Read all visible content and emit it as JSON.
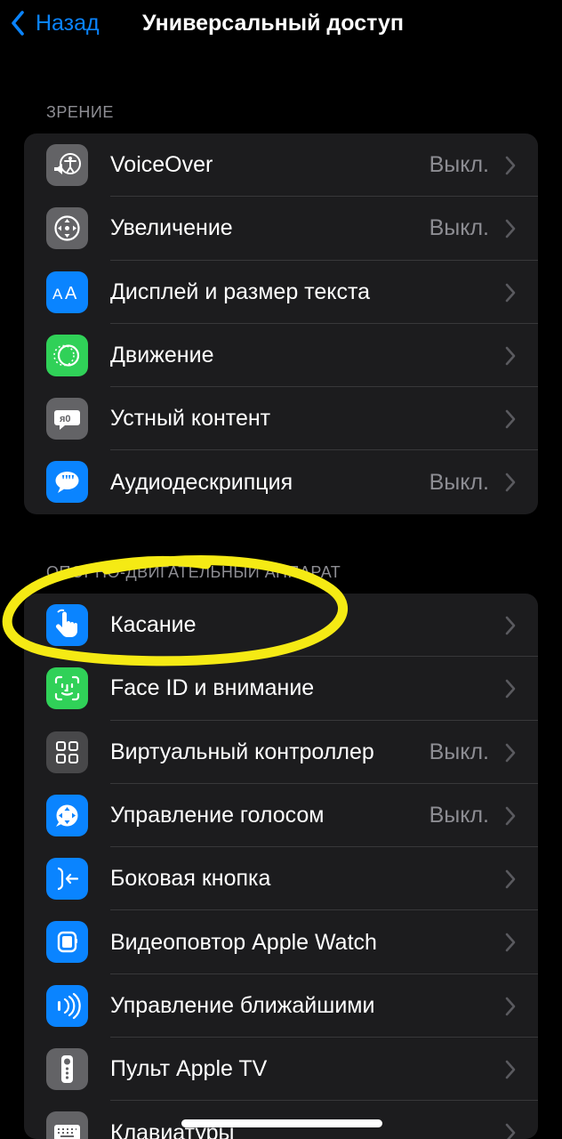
{
  "nav": {
    "back_label": "Назад",
    "title": "Универсальный доступ"
  },
  "vision": {
    "header": "ЗРЕНИЕ",
    "items": [
      {
        "label": "VoiceOver",
        "value": "Выкл.",
        "icon": "voiceover-icon"
      },
      {
        "label": "Увеличение",
        "value": "Выкл.",
        "icon": "zoom-icon"
      },
      {
        "label": "Дисплей и размер текста",
        "value": "",
        "icon": "text-size-icon"
      },
      {
        "label": "Движение",
        "value": "",
        "icon": "motion-icon"
      },
      {
        "label": "Устный контент",
        "value": "",
        "icon": "spoken-content-icon"
      },
      {
        "label": "Аудиодескрипция",
        "value": "Выкл.",
        "icon": "audio-description-icon"
      }
    ]
  },
  "physical": {
    "header": "ОПОРНО-ДВИГАТЕЛЬНЫЙ АППАРАТ",
    "items": [
      {
        "label": "Касание",
        "value": "",
        "icon": "touch-hand-icon"
      },
      {
        "label": "Face ID и внимание",
        "value": "",
        "icon": "face-id-icon"
      },
      {
        "label": "Виртуальный контроллер",
        "value": "Выкл.",
        "icon": "switch-control-icon"
      },
      {
        "label": "Управление голосом",
        "value": "Выкл.",
        "icon": "voice-control-icon"
      },
      {
        "label": "Боковая кнопка",
        "value": "",
        "icon": "side-button-icon"
      },
      {
        "label": "Видеоповтор Apple Watch",
        "value": "",
        "icon": "apple-watch-icon"
      },
      {
        "label": "Управление ближайшими",
        "value": "",
        "icon": "nearby-devices-icon"
      },
      {
        "label": "Пульт Apple TV",
        "value": "",
        "icon": "apple-tv-remote-icon"
      },
      {
        "label": "Клавиатуры",
        "value": "",
        "icon": "keyboard-icon"
      }
    ]
  },
  "colors": {
    "accent": "#0a84ff",
    "highlight": "#f5ea14"
  }
}
